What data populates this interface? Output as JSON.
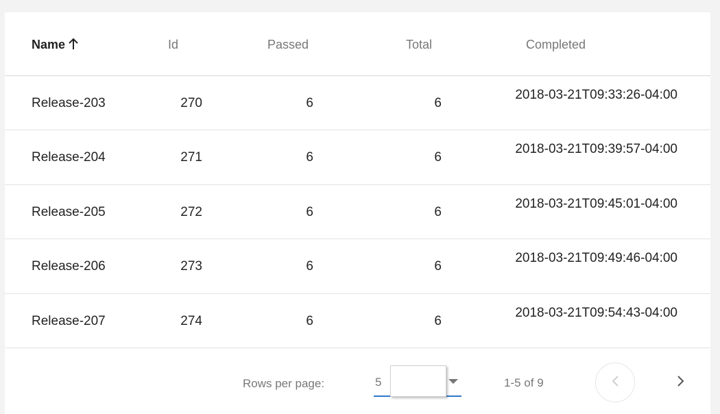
{
  "table": {
    "columns": [
      {
        "label": "Name",
        "sorted": "asc"
      },
      {
        "label": "Id"
      },
      {
        "label": "Passed"
      },
      {
        "label": "Total"
      },
      {
        "label": "Completed"
      }
    ],
    "rows": [
      {
        "name": "Release-203",
        "id": "270",
        "passed": "6",
        "total": "6",
        "completed": "2018-03-21T09:33:26-04:00"
      },
      {
        "name": "Release-204",
        "id": "271",
        "passed": "6",
        "total": "6",
        "completed": "2018-03-21T09:39:57-04:00"
      },
      {
        "name": "Release-205",
        "id": "272",
        "passed": "6",
        "total": "6",
        "completed": "2018-03-21T09:45:01-04:00"
      },
      {
        "name": "Release-206",
        "id": "273",
        "passed": "6",
        "total": "6",
        "completed": "2018-03-21T09:49:46-04:00"
      },
      {
        "name": "Release-207",
        "id": "274",
        "passed": "6",
        "total": "6",
        "completed": "2018-03-21T09:54:43-04:00"
      }
    ]
  },
  "pagination": {
    "rows_per_page_label": "Rows per page:",
    "rows_per_page_value": "5",
    "range_text": "1-5 of 9",
    "prev_icon": "chevron-left-icon",
    "next_icon": "chevron-right-icon"
  },
  "colors": {
    "accent": "#2e78c8",
    "background": "#f3f3f3",
    "card": "#ffffff"
  }
}
